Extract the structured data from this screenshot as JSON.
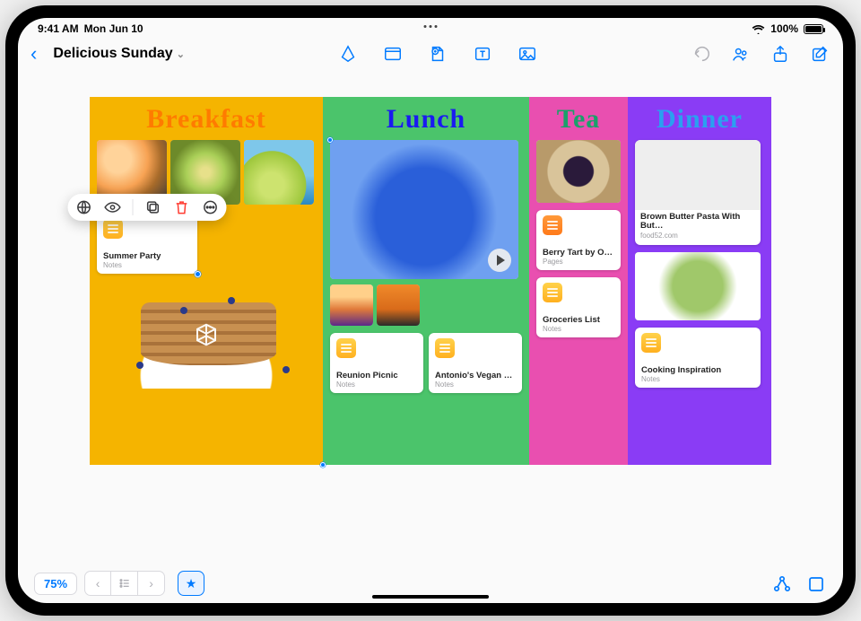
{
  "status": {
    "time": "9:41 AM",
    "date": "Mon Jun 10",
    "battery_pct": "100%"
  },
  "header": {
    "board_title": "Delicious Sunday"
  },
  "columns": {
    "breakfast": {
      "title": "Breakfast"
    },
    "lunch": {
      "title": "Lunch"
    },
    "tea": {
      "title": "Tea"
    },
    "dinner": {
      "title": "Dinner"
    }
  },
  "cards": {
    "summer_party": {
      "title": "Summer Party",
      "subtitle": "Notes"
    },
    "reunion_picnic": {
      "title": "Reunion Picnic",
      "subtitle": "Notes"
    },
    "vegan_tacos": {
      "title": "Antonio's Vegan Tacos",
      "subtitle": "Notes"
    },
    "berry_tart": {
      "title": "Berry Tart by Olivia",
      "subtitle": "Pages"
    },
    "groceries": {
      "title": "Groceries List",
      "subtitle": "Notes"
    },
    "brown_butter": {
      "title": "Brown Butter Pasta With But…",
      "subtitle": "food52.com"
    },
    "cooking_insp": {
      "title": "Cooking Inspiration",
      "subtitle": "Notes"
    }
  },
  "bottom": {
    "zoom": "75%"
  }
}
